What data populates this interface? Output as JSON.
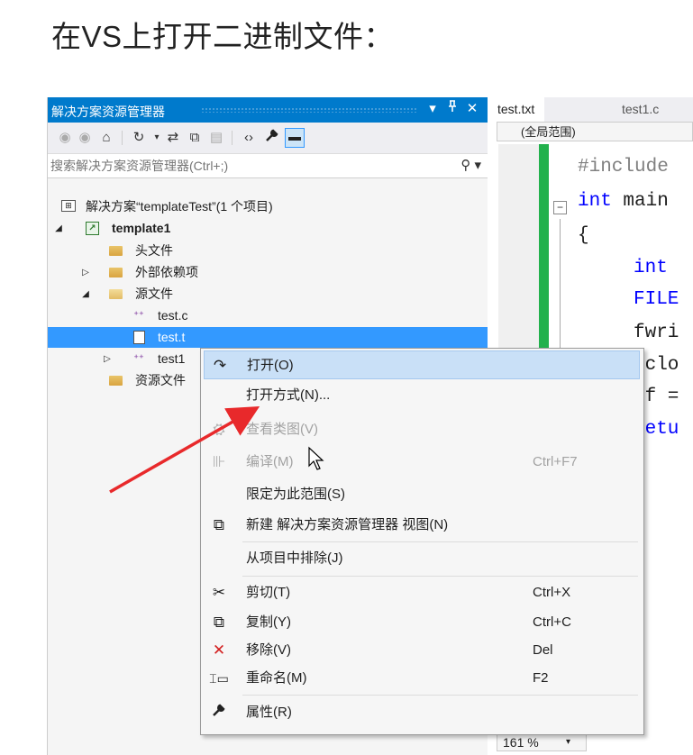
{
  "heading": "在VS上打开二进制文件：",
  "explorer": {
    "title": "解决方案资源管理器",
    "title_buttons": {
      "dropdown": "▾",
      "pin": "ᵖ",
      "close": "✕"
    },
    "search_placeholder": "搜索解决方案资源管理器(Ctrl+;)",
    "tree": {
      "solution": "解决方案“templateTest”(1 个项目)",
      "project": "template1",
      "headers": "头文件",
      "external": "外部依赖项",
      "sources": "源文件",
      "test_c": "test.c",
      "test_txt": "test.t",
      "test1": "test1",
      "resources": "资源文件"
    }
  },
  "editor": {
    "tabs": [
      "test.txt",
      "test1.c"
    ],
    "scope": "(全局范围)",
    "code": {
      "line1_pp": "#include",
      "line2_kw": "int",
      "line2_rest": " main",
      "line3": "{",
      "line4_kw": "int",
      "line5": "FILE",
      "line6": "fwri",
      "line7": "fclo",
      "line8": "pf =",
      "line9": "retu"
    },
    "zoom": "161 %"
  },
  "context_menu": {
    "open": "打开(O)",
    "open_with": "打开方式(N)...",
    "view_class": "查看类图(V)",
    "compile": "编译(M)",
    "compile_shortcut": "Ctrl+F7",
    "scope_to": "限定为此范围(S)",
    "new_view": "新建 解决方案资源管理器 视图(N)",
    "exclude": "从项目中排除(J)",
    "cut": "剪切(T)",
    "cut_shortcut": "Ctrl+X",
    "copy": "复制(Y)",
    "copy_shortcut": "Ctrl+C",
    "remove": "移除(V)",
    "remove_shortcut": "Del",
    "rename": "重命名(M)",
    "rename_shortcut": "F2",
    "properties": "属性(R)"
  },
  "colors": {
    "titlebar": "#007acc",
    "selection": "#3399ff",
    "menu_hover": "#c9e0f7",
    "annotation_arrow": "#e8292b",
    "remove_icon": "#d32020",
    "change_bar": "#22b14c"
  }
}
